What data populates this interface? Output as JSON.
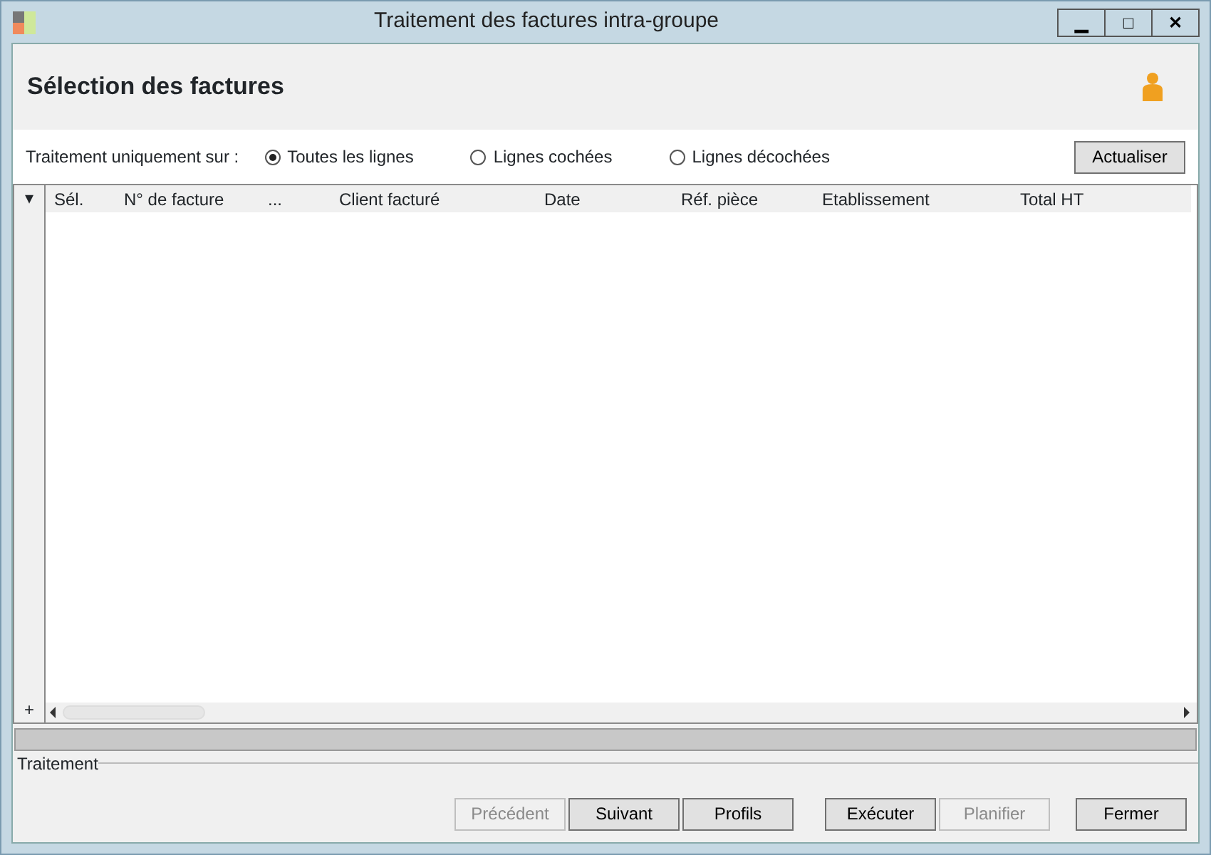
{
  "window": {
    "title": "Traitement des factures intra-groupe",
    "controls": [
      "▁",
      "□",
      "✕"
    ]
  },
  "header": {
    "title": "Sélection des factures"
  },
  "filter": {
    "label": "Traitement uniquement sur :",
    "options": [
      {
        "label": "Toutes les lignes",
        "selected": true
      },
      {
        "label": "Lignes cochées",
        "selected": false
      },
      {
        "label": "Lignes décochées",
        "selected": false
      }
    ],
    "refresh": "Actualiser"
  },
  "table": {
    "menu": "▾",
    "add": "+",
    "columns": [
      "Sél.",
      "N° de facture",
      "...",
      "Client facturé",
      "Date",
      "Réf. pièce",
      "Etablissement",
      "Total HT"
    ]
  },
  "group": {
    "title": "Traitement"
  },
  "buttons": [
    {
      "label": "Précédent",
      "disabled": true
    },
    {
      "label": "Suivant",
      "disabled": false
    },
    {
      "label": "Profils",
      "disabled": false
    },
    {
      "label": "Exécuter",
      "disabled": false
    },
    {
      "label": "Planifier",
      "disabled": true
    },
    {
      "label": "Fermer",
      "disabled": false
    }
  ]
}
